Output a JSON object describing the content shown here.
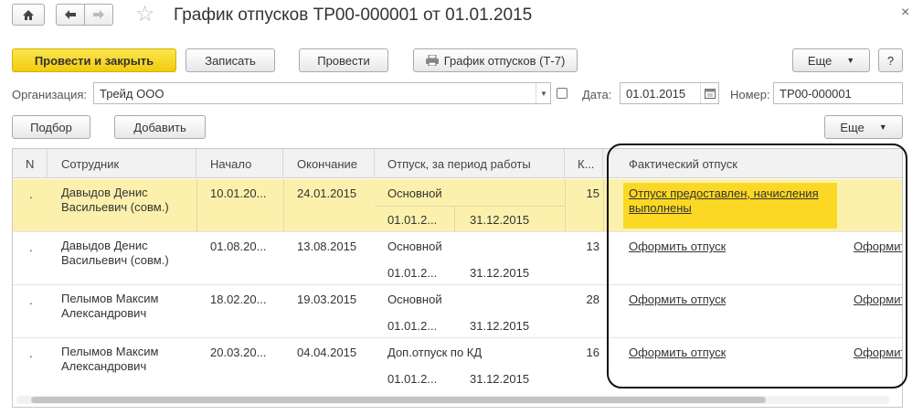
{
  "window": {
    "title": "График отпусков ТР00-000001 от 01.01.2015",
    "close": "×"
  },
  "icons": {
    "home": "home-icon",
    "back": "arrow-left-icon",
    "forward": "arrow-right-icon",
    "favorite": "star-icon",
    "close": "close-icon",
    "printer": "printer-icon",
    "dropdown": "triangle-down-icon",
    "calendar": "calendar-icon",
    "open": "open-link-icon"
  },
  "toolbar": {
    "post_close": "Провести и закрыть",
    "save": "Записать",
    "post": "Провести",
    "print_t7": "График отпусков (Т-7)",
    "more": "Еще",
    "help": "?"
  },
  "form": {
    "org_label": "Организация:",
    "org_value": "Трейд ООО",
    "date_label": "Дата:",
    "date_value": "01.01.2015",
    "number_label": "Номер:",
    "number_value": "ТР00-000001"
  },
  "table_toolbar": {
    "pick": "Подбор",
    "add": "Добавить",
    "more": "Еще"
  },
  "table": {
    "headers": {
      "n": "N",
      "employee": "Сотрудник",
      "start": "Начало",
      "end": "Окончание",
      "vacation": "Отпуск, за период работы",
      "days": "К...",
      "actual": "Фактический отпуск"
    },
    "rows": [
      {
        "n": ".",
        "employee": "Давыдов Денис Васильевич (совм.)",
        "start": "10.01.20...",
        "end": "24.01.2015",
        "type": "Основной",
        "period_from": "01.01.2...",
        "period_to": "31.12.2015",
        "days": "15",
        "actual": "Отпуск предоставлен, начисления выполнены",
        "extra": ""
      },
      {
        "n": ".",
        "employee": "Давыдов Денис Васильевич (совм.)",
        "start": "01.08.20...",
        "end": "13.08.2015",
        "type": "Основной",
        "period_from": "01.01.2...",
        "period_to": "31.12.2015",
        "days": "13",
        "actual": "Оформить отпуск",
        "extra": "Оформит"
      },
      {
        "n": ".",
        "employee": "Пелымов Максим Александрович",
        "start": "18.02.20...",
        "end": "19.03.2015",
        "type": "Основной",
        "period_from": "01.01.2...",
        "period_to": "31.12.2015",
        "days": "28",
        "actual": "Оформить отпуск",
        "extra": "Оформит"
      },
      {
        "n": ".",
        "employee": "Пелымов Максим Александрович",
        "start": "20.03.20...",
        "end": "04.04.2015",
        "type": "Доп.отпуск по КД",
        "period_from": "01.01.2...",
        "period_to": "31.12.2015",
        "days": "16",
        "actual": "Оформить отпуск",
        "extra": "Оформит"
      }
    ]
  },
  "colors": {
    "primary_button": "#f5d31a",
    "selected_row": "#fcf1ac",
    "status_badge": "#fbd823"
  }
}
